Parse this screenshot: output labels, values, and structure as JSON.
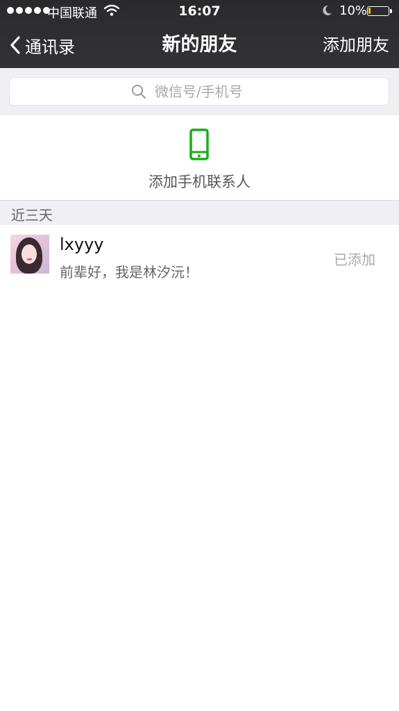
{
  "status_bar": {
    "carrier": "中国联通",
    "time": "16:07",
    "battery_percent": "10%",
    "battery_level": 0.1
  },
  "nav": {
    "back_label": "通讯录",
    "title": "新的朋友",
    "right_action": "添加朋友"
  },
  "search": {
    "placeholder": "微信号/手机号"
  },
  "add_phone_contacts": {
    "label": "添加手机联系人",
    "icon": "phone-icon"
  },
  "recent_section": {
    "title": "近三天",
    "items": [
      {
        "name": "lxyyy",
        "message": "前辈好，我是林汐沅！",
        "status": "已添加"
      }
    ]
  },
  "colors": {
    "nav_background": "#2f2f33",
    "accent_green": "#1aad19",
    "section_background": "#efeff4"
  }
}
